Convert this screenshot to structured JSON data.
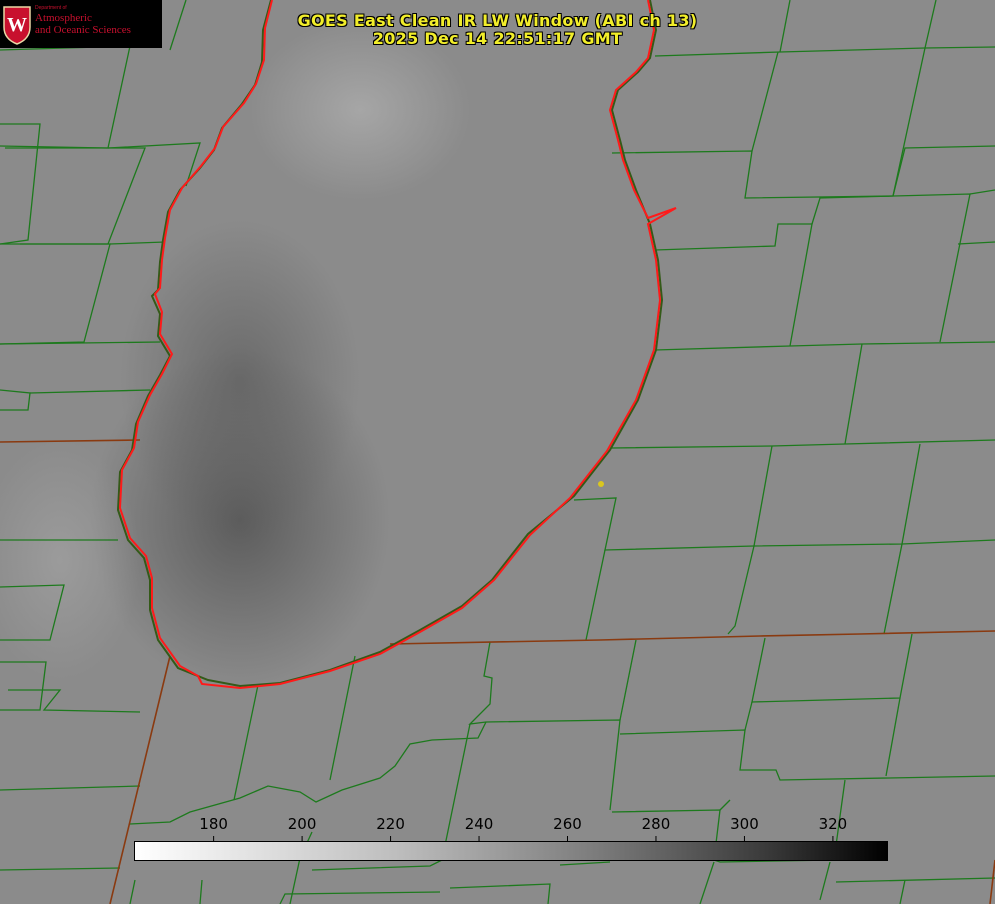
{
  "title": {
    "line1": "GOES East Clean IR LW Window (ABI ch 13)",
    "line2": "2025 Dec 14 22:51:17 GMT"
  },
  "logo": {
    "dept": "Department of",
    "name_line1": "Atmospheric",
    "name_line2": "and Oceanic Sciences",
    "seal_letter": "W"
  },
  "colorbar": {
    "ticks": [
      "180",
      "200",
      "220",
      "240",
      "260",
      "280",
      "300",
      "320"
    ],
    "range": [
      162,
      332
    ],
    "colormap": "white-to-black grayscale"
  },
  "colors": {
    "title": "#f2ee2a",
    "county_lines": "#1d7a1d",
    "state_lines": "#8a3a10",
    "lake_outline": "#ff1a1a",
    "city_marker": "#d9c61f"
  }
}
